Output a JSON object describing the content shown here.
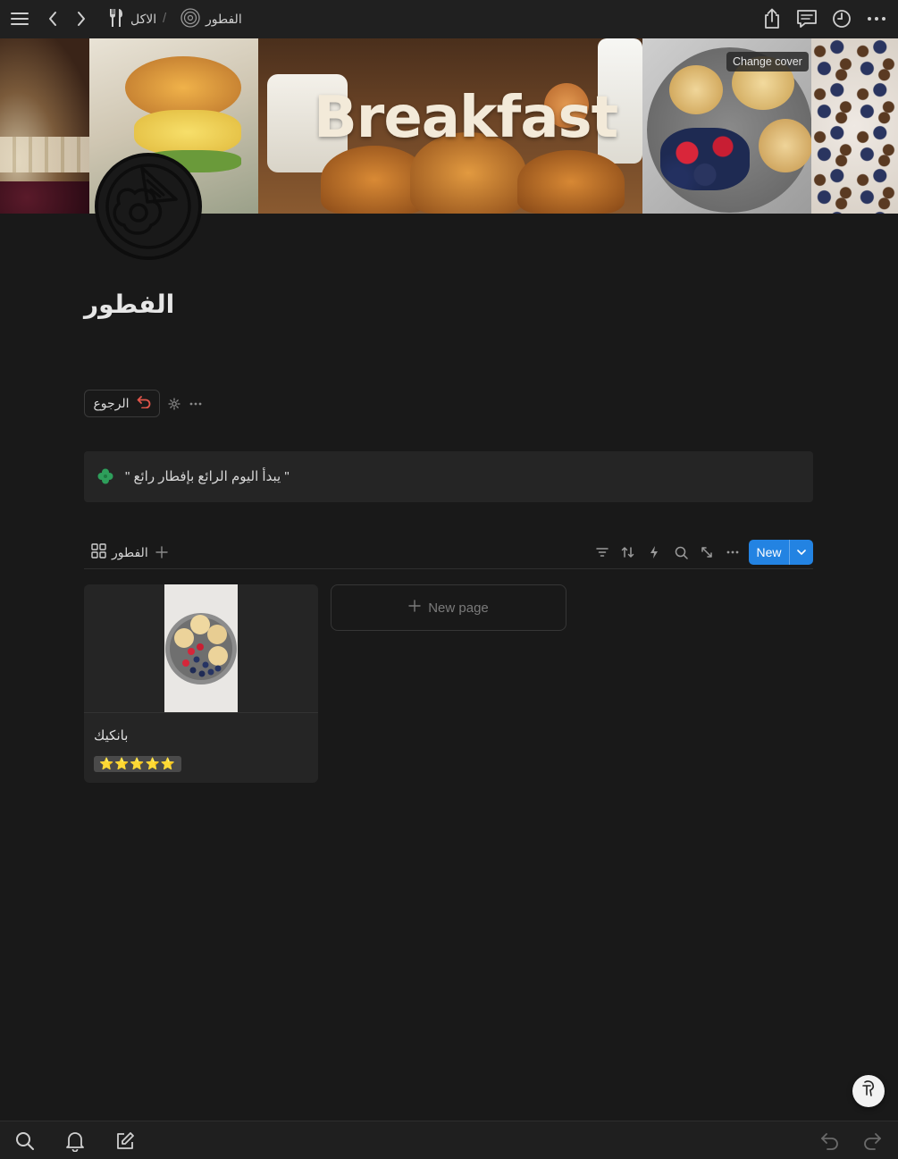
{
  "topbar": {
    "breadcrumbs": [
      {
        "label": "الاكل",
        "icon": "fork-knife-icon"
      },
      {
        "label": "الفطور",
        "icon": "plate-icon"
      }
    ],
    "separator": "/"
  },
  "cover": {
    "title": "Breakfast",
    "change_cover_label": "Change cover"
  },
  "page": {
    "title": "الفطور",
    "back_button_label": "الرجوع"
  },
  "callout": {
    "icon": "clover-icon",
    "text": "\" يبدأ اليوم الرائع بإفطار رائع \""
  },
  "database": {
    "view_label": "الفطور",
    "new_button_label": "New",
    "new_page_label": "New page",
    "cards": [
      {
        "title": "بانكيك",
        "rating": "⭐⭐⭐⭐⭐",
        "rating_value": 5
      }
    ]
  },
  "colors": {
    "background": "#191919",
    "accent": "#2383e2",
    "callout_icon": "#2e9e5b",
    "back_icon": "#e0554a"
  }
}
